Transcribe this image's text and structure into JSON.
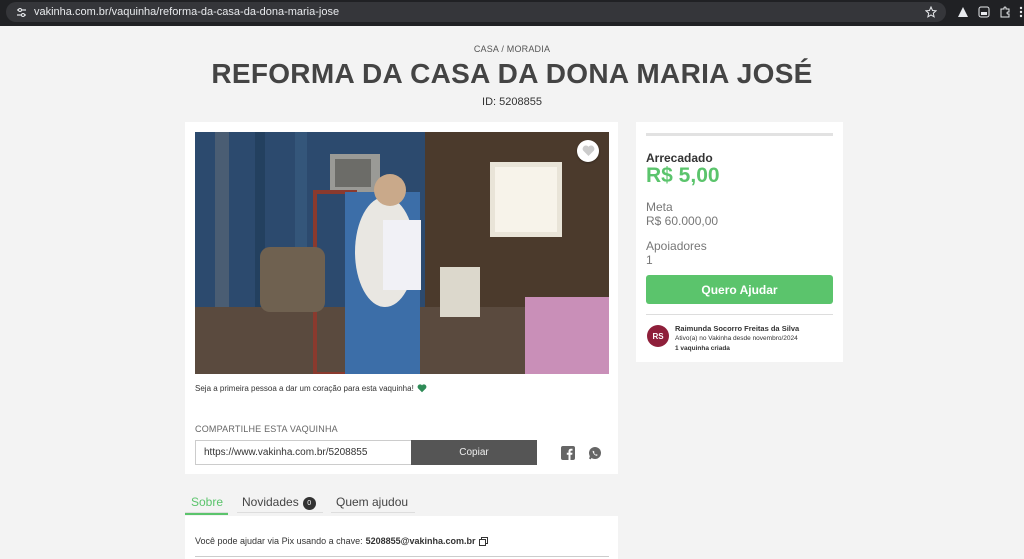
{
  "browser": {
    "url": "vakinha.com.br/vaquinha/reforma-da-casa-da-dona-maria-jose",
    "icons": [
      "tune-icon",
      "star-icon",
      "extension-icon",
      "profile-icon",
      "puzzle-icon",
      "menu-icon"
    ]
  },
  "header": {
    "category": "CASA / MORADIA",
    "title": "REFORMA DA CASA DA DONA MARIA JOSÉ",
    "id_label": "ID: 5208855"
  },
  "campaign": {
    "first_heart_message": "Seja a primeira pessoa a dar um coração para esta vaquinha!",
    "share_label": "COMPARTILHE ESTA VAQUINHA",
    "share_url": "https://www.vakinha.com.br/5208855",
    "copy_label": "Copiar"
  },
  "stats": {
    "raised_label": "Arrecadado",
    "raised_value": "R$ 5,00",
    "goal_label": "Meta",
    "goal_value": "R$ 60.000,00",
    "supporters_label": "Apoiadores",
    "supporters_value": "1",
    "help_button": "Quero Ajudar",
    "progress_fraction": 0.0001
  },
  "owner": {
    "initials": "RS",
    "name": "Raimunda Socorro Freitas da Silva",
    "since": "Ativo(a) no Vakinha desde novembro/2024",
    "count": "1 vaquinha criada"
  },
  "tabs": [
    {
      "label": "Sobre",
      "active": true
    },
    {
      "label": "Novidades",
      "badge": "0",
      "active": false
    },
    {
      "label": "Quem ajudou",
      "active": false
    }
  ],
  "about": {
    "pix_text": "Você pode ajudar via Pix usando a chave:",
    "pix_key": "5208855@vakinha.com.br"
  },
  "colors": {
    "accent_green": "#5bc46c",
    "avatar": "#8e1f3a",
    "copy_button": "#555555"
  }
}
